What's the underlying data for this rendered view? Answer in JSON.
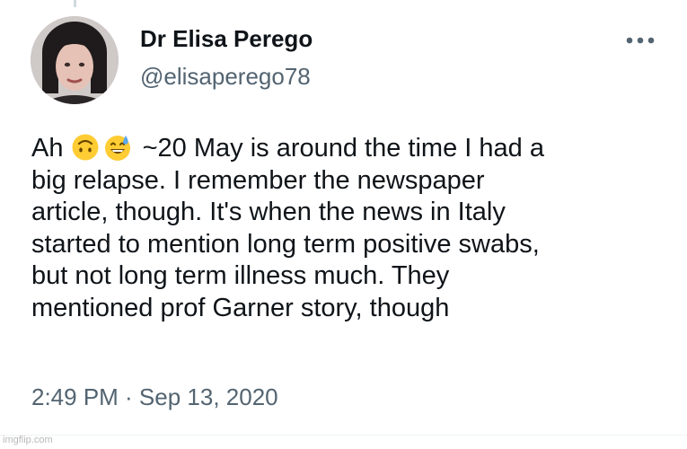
{
  "tweet": {
    "author": {
      "display_name": "Dr Elisa Perego",
      "handle": "@elisaperego78"
    },
    "body_lines": [
      {
        "prefix": "Ah",
        "emojis": [
          "upside-down-face",
          "grinning-face-with-sweat"
        ],
        "text": "~20 May is around the time I had a"
      },
      {
        "text": "big relapse. I remember the newspaper"
      },
      {
        "text": "article, though. It's when the news in Italy"
      },
      {
        "text": "started to mention long term positive swabs,"
      },
      {
        "text": "but not long term illness much. They"
      },
      {
        "text": "mentioned prof Garner story, though"
      }
    ],
    "timestamp": "2:49 PM · Sep 13, 2020",
    "more_icon": "more-horizontal-icon"
  },
  "watermark": "imgflip.com",
  "colors": {
    "text_primary": "#0f1419",
    "text_secondary": "#536471",
    "emoji_yellow": "#ffcc33",
    "sweat_blue": "#5aa7e8"
  }
}
